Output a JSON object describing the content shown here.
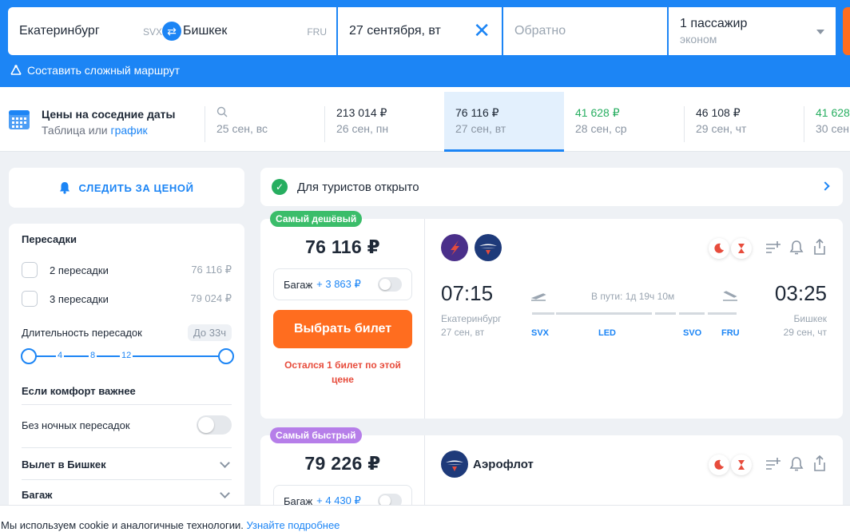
{
  "search": {
    "from_city": "Екатеринбург",
    "from_code": "SVX",
    "to_city": "Бишкек",
    "to_code": "FRU",
    "depart_date": "27 сентября, вт",
    "return_placeholder": "Обратно",
    "passengers": "1 пассажир",
    "cabin": "эконом",
    "complex_route": "Составить сложный маршрут"
  },
  "nearby": {
    "title": "Цены на соседние даты",
    "sub_prefix": "Таблица",
    "sub_or": "или",
    "sub_link": "график",
    "dates": [
      {
        "price": "",
        "date": "25 сен, вс"
      },
      {
        "price": "213 014 ₽",
        "date": "26 сен, пн"
      },
      {
        "price": "76 116 ₽",
        "date": "27 сен, вт"
      },
      {
        "price": "41 628 ₽",
        "date": "28 сен, ср"
      },
      {
        "price": "46 108 ₽",
        "date": "29 сен, чт"
      },
      {
        "price": "41 628",
        "date": "30 сен"
      }
    ]
  },
  "watch_price": "СЛЕДИТЬ ЗА ЦЕНОЙ",
  "filters": {
    "stops_title": "Пересадки",
    "stops": [
      {
        "label": "2 пересадки",
        "price": "76 116 ₽"
      },
      {
        "label": "3 пересадки",
        "price": "79 024 ₽"
      }
    ],
    "duration_label": "Длительность пересадок",
    "duration_badge": "До 33ч",
    "ticks": [
      "4",
      "8",
      "12"
    ],
    "comfort_title": "Если комфорт важнее",
    "no_night": "Без ночных пересадок",
    "depart_section": "Вылет в Бишкек",
    "baggage_section": "Багаж"
  },
  "tourist_banner": "Для туристов открыто",
  "tickets": [
    {
      "tag": "Самый дешёвый",
      "price": "76 116 ₽",
      "bag_label": "Багаж",
      "bag_price": "+ 3 863 ₽",
      "buy": "Выбрать билет",
      "last_ticket": "Остался 1 билет по этой цене",
      "dep_time": "07:15",
      "arr_time": "03:25",
      "dep_city": "Екатеринбург",
      "arr_city": "Бишкек",
      "dep_date": "27 сен, вт",
      "arr_date": "29 сен, чт",
      "duration": "В пути: 1д 19ч 10м",
      "stops": [
        "SVX",
        "LED",
        "SVO",
        "FRU"
      ]
    },
    {
      "tag": "Самый быстрый",
      "price": "79 226 ₽",
      "airline": "Аэрофлот",
      "bag_label": "Багаж",
      "bag_price": "+ 4 430 ₽"
    }
  ],
  "cookie": {
    "text": "Мы используем cookie и аналогичные технологии.",
    "link": "Узнайте подробнее"
  },
  "colors": {
    "brand_blue": "#1c85f5",
    "orange": "#ff6d1f",
    "green": "#27ae60",
    "tag_green": "#3bbd6a",
    "tag_purple": "#b67ee9",
    "warning_red": "#e74c3c"
  }
}
